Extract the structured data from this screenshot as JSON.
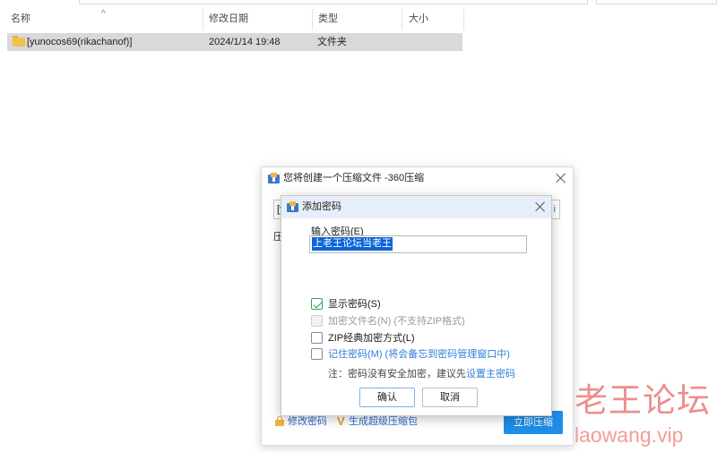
{
  "explorer": {
    "columns": {
      "name": "名称",
      "modified": "修改日期",
      "type": "类型",
      "size": "大小"
    },
    "sort_indicator": "^",
    "row": {
      "name": "[yunocos69(rikachanof)]",
      "modified": "2024/1/14 19:48",
      "type": "文件夹",
      "size": ""
    }
  },
  "outer_dialog": {
    "title": "您将创建一个压缩文件 -360压缩",
    "name_field_value": "[y",
    "browse_glyph": "i",
    "row_label": "压",
    "modify_password_link": "修改密码",
    "super_package_link": "生成超级压缩包",
    "compress_button": "立即压缩",
    "accent_color": "#1e8ee9"
  },
  "password_dialog": {
    "title": "添加密码",
    "input_label": "输入密码(E)",
    "password_value": "上老王论坛当老王",
    "options": {
      "show_password": {
        "label": "显示密码(S)",
        "checked": true
      },
      "encrypt_filenames": {
        "label": "加密文件名(N) (不支持ZIP格式)",
        "checked": false,
        "disabled": true
      },
      "zip_classic": {
        "label": "ZIP经典加密方式(L)",
        "checked": false
      },
      "remember_password": {
        "label": "记住密码(M) (将会备忘到密码管理窗口中)",
        "checked": false
      }
    },
    "note_prefix": "注：密码没有安全加密，建议先",
    "note_link": "设置主密码",
    "ok_button": "确认",
    "cancel_button": "取消"
  },
  "watermark": {
    "name": "老王论坛",
    "url": "laowang.vip"
  },
  "icons": [
    "folder-icon",
    "app-icon",
    "close-icon",
    "lock-icon",
    "v-icon",
    "checkbox-icon"
  ]
}
